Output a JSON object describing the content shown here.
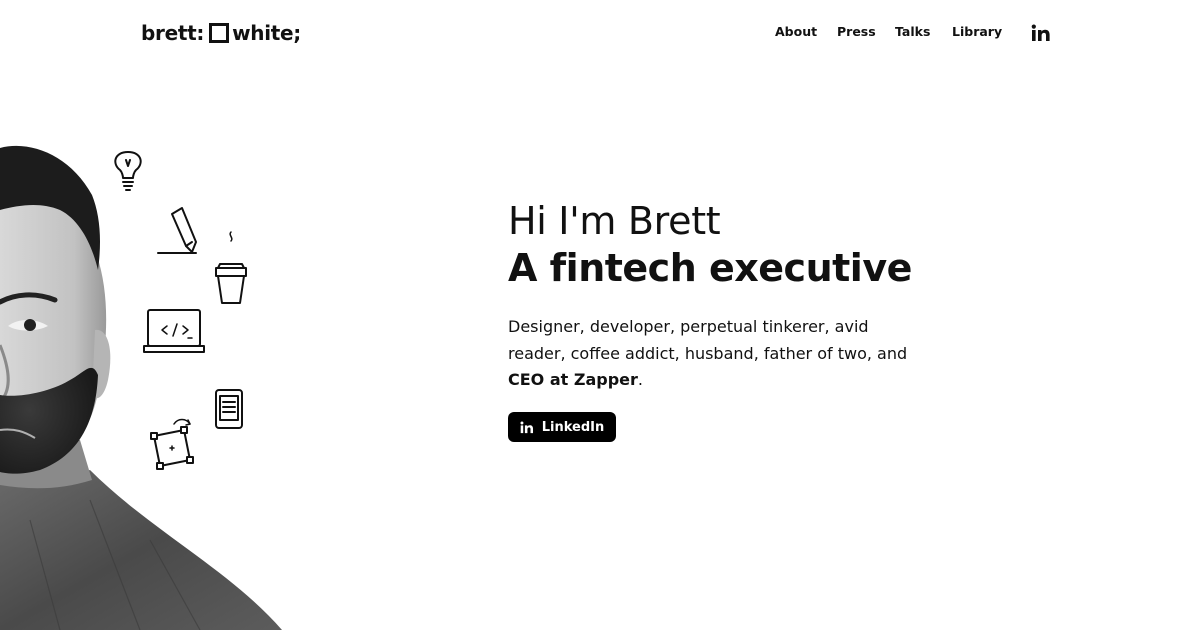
{
  "header": {
    "logo_left": "brett:",
    "logo_right": "white;",
    "nav": [
      {
        "label": "About"
      },
      {
        "label": "Press"
      },
      {
        "label": "Talks"
      },
      {
        "label": "Library"
      }
    ],
    "social_icon": "linkedin-icon"
  },
  "hero": {
    "greeting": "Hi I'm Brett",
    "headline": "A fintech executive",
    "bio_text": "Designer, developer, perpetual tinkerer, avid reader, coffee addict, husband, father of two, and ",
    "bio_bold": "CEO at Zapper",
    "bio_end": ".",
    "cta_label": "LinkedIn",
    "cta_icon": "linkedin-icon"
  },
  "illustration": {
    "portrait": "black-and-white-portrait",
    "doodles": [
      "lightbulb-icon",
      "pencil-icon",
      "coffee-cup-icon",
      "laptop-code-icon",
      "ereader-icon",
      "transform-box-icon"
    ]
  },
  "colors": {
    "text": "#111111",
    "background": "#ffffff",
    "button": "#000000",
    "button_text": "#ffffff"
  }
}
